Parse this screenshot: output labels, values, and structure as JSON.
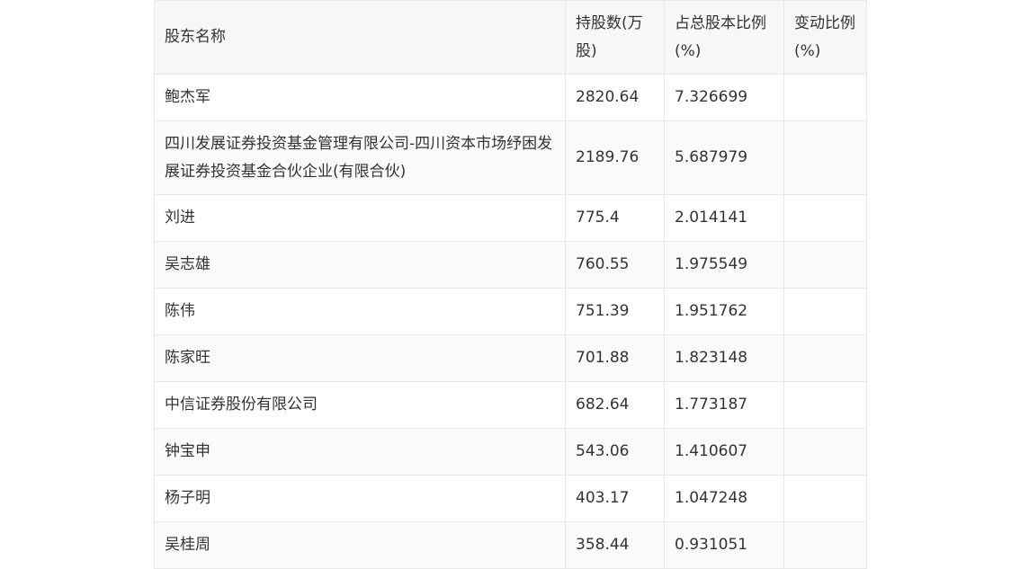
{
  "table": {
    "headers": [
      "股东名称",
      "持股数(万股)",
      "占总股本比例(%)",
      "变动比例(%)"
    ],
    "rows": [
      [
        "鲍杰军",
        "2820.64",
        "7.326699",
        ""
      ],
      [
        "四川发展证券投资基金管理有限公司-四川资本市场纾困发展证券投资基金合伙企业(有限合伙)",
        "2189.76",
        "5.687979",
        ""
      ],
      [
        "刘进",
        "775.4",
        "2.014141",
        ""
      ],
      [
        "吴志雄",
        "760.55",
        "1.975549",
        ""
      ],
      [
        "陈伟",
        "751.39",
        "1.951762",
        ""
      ],
      [
        "陈家旺",
        "701.88",
        "1.823148",
        ""
      ],
      [
        "中信证券股份有限公司",
        "682.64",
        "1.773187",
        ""
      ],
      [
        "钟宝申",
        "543.06",
        "1.410607",
        ""
      ],
      [
        "杨子明",
        "403.17",
        "1.047248",
        ""
      ],
      [
        "吴桂周",
        "358.44",
        "0.931051",
        ""
      ]
    ]
  }
}
